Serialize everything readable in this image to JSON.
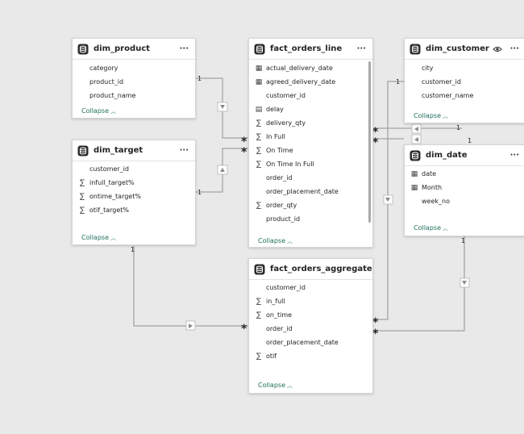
{
  "tables": {
    "dim_product": {
      "title": "dim_product",
      "fields": [
        {
          "icon": "none",
          "name": "category"
        },
        {
          "icon": "none",
          "name": "product_id"
        },
        {
          "icon": "none",
          "name": "product_name"
        }
      ],
      "collapse_label": "Collapse"
    },
    "dim_target": {
      "title": "dim_target",
      "fields": [
        {
          "icon": "none",
          "name": "customer_id"
        },
        {
          "icon": "sigma",
          "name": "infull_target%"
        },
        {
          "icon": "sigma",
          "name": "ontime_target%"
        },
        {
          "icon": "sigma",
          "name": "otif_target%"
        }
      ],
      "collapse_label": "Collapse"
    },
    "fact_orders_line": {
      "title": "fact_orders_line",
      "fields": [
        {
          "icon": "calendar",
          "name": "actual_delivery_date"
        },
        {
          "icon": "calendar",
          "name": "agreed_delivery_date"
        },
        {
          "icon": "none",
          "name": "customer_id"
        },
        {
          "icon": "calc",
          "name": "delay"
        },
        {
          "icon": "sigma",
          "name": "delivery_qty"
        },
        {
          "icon": "sigma",
          "name": "In Full"
        },
        {
          "icon": "sigma",
          "name": "On Time"
        },
        {
          "icon": "sigma",
          "name": "On Time In Full"
        },
        {
          "icon": "none",
          "name": "order_id"
        },
        {
          "icon": "none",
          "name": "order_placement_date"
        },
        {
          "icon": "sigma",
          "name": "order_qty"
        },
        {
          "icon": "none",
          "name": "product_id"
        }
      ],
      "collapse_label": "Collapse"
    },
    "dim_customer": {
      "title": "dim_customer",
      "fields": [
        {
          "icon": "none",
          "name": "city"
        },
        {
          "icon": "none",
          "name": "customer_id"
        },
        {
          "icon": "none",
          "name": "customer_name"
        }
      ],
      "collapse_label": "Collapse"
    },
    "dim_date": {
      "title": "dim_date",
      "fields": [
        {
          "icon": "calendar",
          "name": "date"
        },
        {
          "icon": "calendar",
          "name": "Month"
        },
        {
          "icon": "none",
          "name": "week_no"
        }
      ],
      "collapse_label": "Collapse"
    },
    "fact_orders_aggregate": {
      "title": "fact_orders_aggregate",
      "fields": [
        {
          "icon": "none",
          "name": "customer_id"
        },
        {
          "icon": "sigma",
          "name": "in_full"
        },
        {
          "icon": "sigma",
          "name": "on_time"
        },
        {
          "icon": "none",
          "name": "order_id"
        },
        {
          "icon": "none",
          "name": "order_placement_date"
        },
        {
          "icon": "sigma",
          "name": "otif"
        }
      ],
      "collapse_label": "Collapse"
    }
  },
  "more_label": "···",
  "relationships": [
    {
      "from": "dim_product",
      "to": "fact_orders_line",
      "one_label": "1",
      "many_label": "*"
    },
    {
      "from": "dim_target",
      "to": "fact_orders_line",
      "one_label": "1",
      "many_label": "*"
    },
    {
      "from": "dim_customer",
      "to": "fact_orders_line",
      "one_label": "1",
      "many_label": "*"
    },
    {
      "from": "dim_date",
      "to": "fact_orders_line",
      "one_label": "1",
      "many_label": "*"
    },
    {
      "from": "dim_customer",
      "to": "fact_orders_aggregate",
      "one_label": "1",
      "many_label": "*"
    },
    {
      "from": "dim_date",
      "to": "fact_orders_aggregate",
      "one_label": "1",
      "many_label": "*"
    },
    {
      "from": "dim_target",
      "to": "fact_orders_aggregate",
      "one_label": "1",
      "many_label": "*"
    }
  ],
  "colors": {
    "canvas": "#e9e9e9",
    "line": "#a3a3a3",
    "collapse": "#1f6f5c"
  }
}
